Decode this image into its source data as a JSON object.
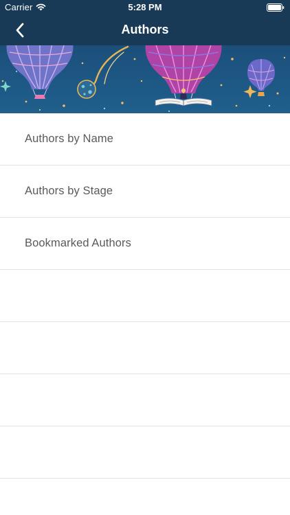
{
  "status_bar": {
    "carrier": "Carrier",
    "time": "5:28 PM",
    "wifi_icon": "wifi-icon",
    "battery_icon": "battery-full-icon"
  },
  "nav": {
    "title": "Authors",
    "back_icon": "chevron-left-icon"
  },
  "banner": {
    "description_icon": "hot-air-balloons-illustration"
  },
  "menu": {
    "items": [
      {
        "label": "Authors by Name"
      },
      {
        "label": "Authors by Stage"
      },
      {
        "label": "Bookmarked Authors"
      },
      {
        "label": ""
      },
      {
        "label": ""
      },
      {
        "label": ""
      },
      {
        "label": ""
      }
    ]
  },
  "colors": {
    "nav_background": "#183a56",
    "banner_background": "#1f5a86",
    "row_text": "#5a5a5a",
    "separator": "#e2e2e2"
  }
}
